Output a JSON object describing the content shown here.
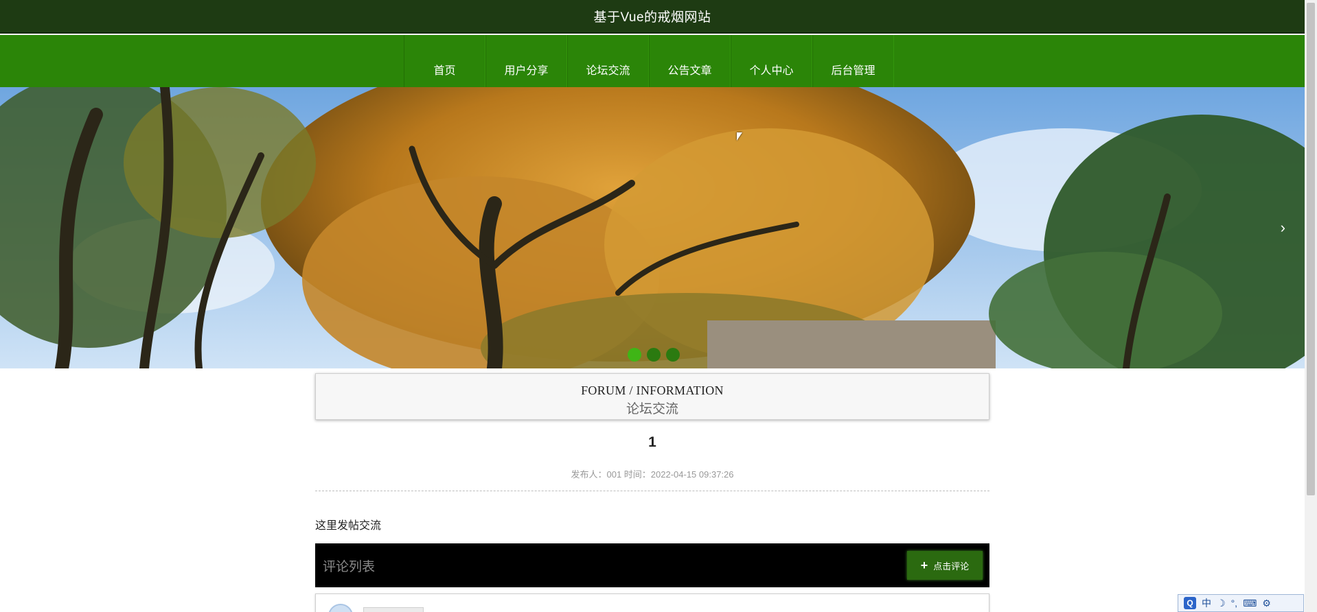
{
  "header": {
    "site_title": "基于Vue的戒烟网站"
  },
  "nav": {
    "items": [
      {
        "label": "首页"
      },
      {
        "label": "用户分享"
      },
      {
        "label": "论坛交流"
      },
      {
        "label": "公告文章"
      },
      {
        "label": "个人中心"
      },
      {
        "label": "后台管理"
      }
    ]
  },
  "banner": {
    "next_arrow": "›",
    "dots": [
      {
        "state": "active"
      },
      {
        "state": "inactive"
      },
      {
        "state": "inactive"
      }
    ]
  },
  "section": {
    "title_en": "FORUM / INFORMATION",
    "title_cn": "论坛交流"
  },
  "post": {
    "title": "1",
    "meta": "发布人：001 时间：2022-04-15 09:37:26",
    "body": "这里发帖交流"
  },
  "comments": {
    "header_title": "评论列表",
    "add_button_label": "点击评论",
    "add_button_icon": "+"
  },
  "ime": {
    "logo": "Q",
    "mode": "中",
    "moon": "☽",
    "punct": "°,",
    "keyboard": "⌨",
    "settings": "⚙"
  },
  "colors": {
    "topbar": "#1e3b13",
    "navbar": "#2b8508",
    "accent_button": "#2b6a10",
    "comment_header": "#000000",
    "dot_active": "#3fb516"
  }
}
